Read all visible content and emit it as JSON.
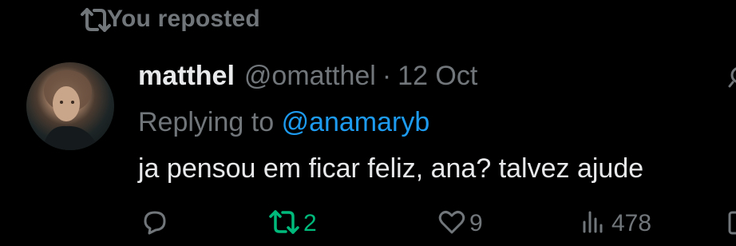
{
  "repost_header": {
    "icon": "repost-icon",
    "text": "You reposted"
  },
  "post": {
    "author": {
      "name": "matthel",
      "handle": "@omatthel",
      "avatar_icon": "avatar"
    },
    "separator": "·",
    "date": "12 Oct",
    "replying_prefix": "Replying to",
    "replying_to": "@anamaryb",
    "text": "ja pensou em ficar feliz, ana? talvez ajude"
  },
  "actions": {
    "reply": {
      "icon": "reply-icon"
    },
    "repost": {
      "icon": "repost-icon",
      "count": "2",
      "color": "#00ba7c"
    },
    "like": {
      "icon": "heart-icon",
      "count": "9"
    },
    "views": {
      "icon": "views-icon",
      "count": "478"
    }
  },
  "colors": {
    "background": "#000000",
    "text": "#e7e9ea",
    "muted": "#71767b",
    "link": "#1d9bf0",
    "repost_active": "#00ba7c"
  }
}
